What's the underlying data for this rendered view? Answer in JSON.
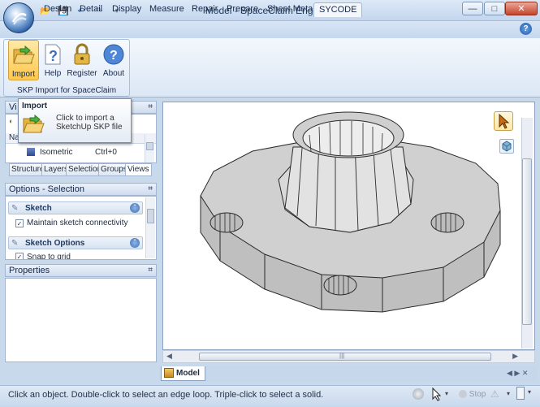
{
  "window": {
    "title": "Model - SpaceClaim Engineer"
  },
  "tabs": [
    "Design",
    "Detail",
    "Display",
    "Measure",
    "Repair",
    "Prepare",
    "Sheet Metal",
    "SYCODE"
  ],
  "active_tab": "SYCODE",
  "ribbon": {
    "group_label": "SKP Import for SpaceClaim",
    "buttons": [
      {
        "label": "Import",
        "icon": "folder-open-icon"
      },
      {
        "label": "Help",
        "icon": "help-document-icon"
      },
      {
        "label": "Register",
        "icon": "lock-icon"
      },
      {
        "label": "About",
        "icon": "about-icon"
      }
    ]
  },
  "tooltip": {
    "title": "Import",
    "description": "Click to import a SketchUp SKP file"
  },
  "views_panel": {
    "title": "Vi",
    "columns": {
      "name": "Name"
    },
    "row": {
      "name": "Isometric",
      "shortcut": "Ctrl+0"
    }
  },
  "panel_tabs": [
    "Structure",
    "Layers",
    "Selection",
    "Groups",
    "Views"
  ],
  "active_panel_tab": "Views",
  "options_panel": {
    "title": "Options - Selection",
    "sections": [
      {
        "label": "Sketch",
        "option": "Maintain sketch connectivity",
        "checked": true
      },
      {
        "label": "Sketch Options",
        "option": "Snap to grid",
        "checked": true
      }
    ]
  },
  "properties_panel": {
    "title": "Properties"
  },
  "document_tab": "Model",
  "status": {
    "message": "Click an object. Double-click to select an edge loop. Triple-click to select a solid.",
    "stop_label": "Stop"
  }
}
